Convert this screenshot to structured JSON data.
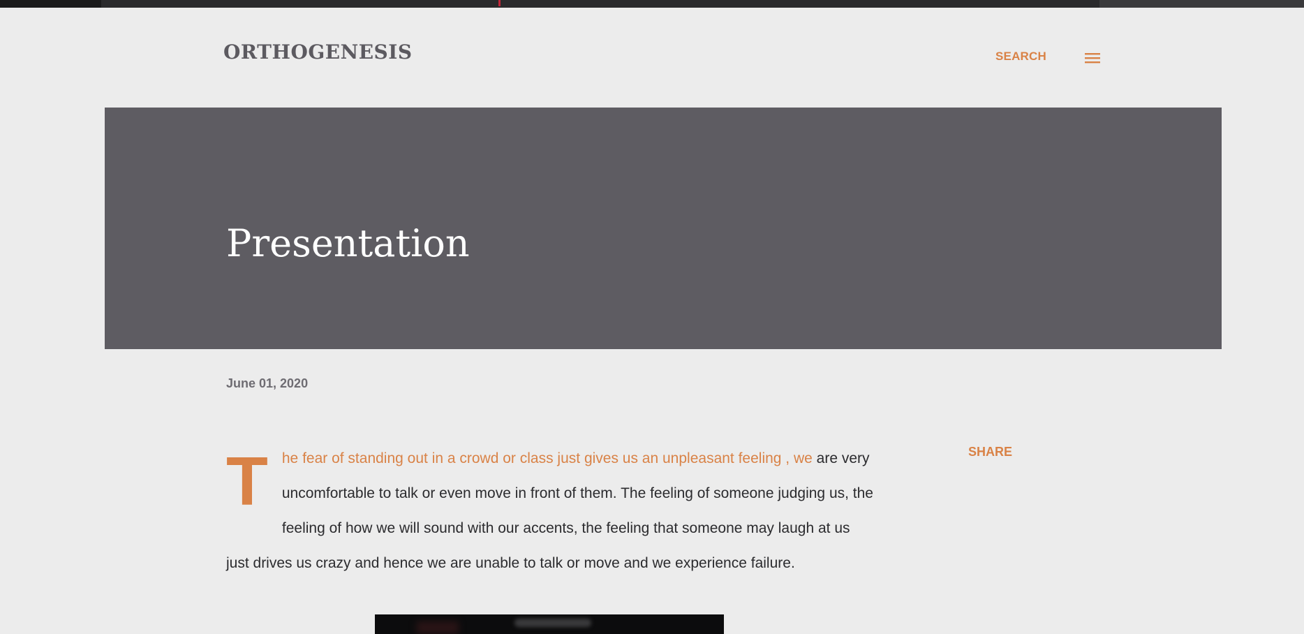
{
  "header": {
    "site_title": "ORTHOGENESIS",
    "search_label": "SEARCH",
    "menu_icon": "hamburger-menu-icon"
  },
  "post": {
    "title": "Presentation",
    "date": "June 01, 2020",
    "drop_cap": "T",
    "lead_text": "he fear of standing out in a crowd or class just gives us an unpleasant feeling , we",
    "body_text": "are very uncomfortable to talk or even move in front of them. The feeling of someone judging us, the feeling of how we will sound with our accents, the feeling that someone may laugh at us just drives us crazy and hence we are unable to talk or move and we experience failure.",
    "share_label": "SHARE"
  },
  "colors": {
    "accent": "#d98246",
    "hero_background": "#5e5c62",
    "page_background": "#ececec",
    "text": "#2b2b2e"
  }
}
